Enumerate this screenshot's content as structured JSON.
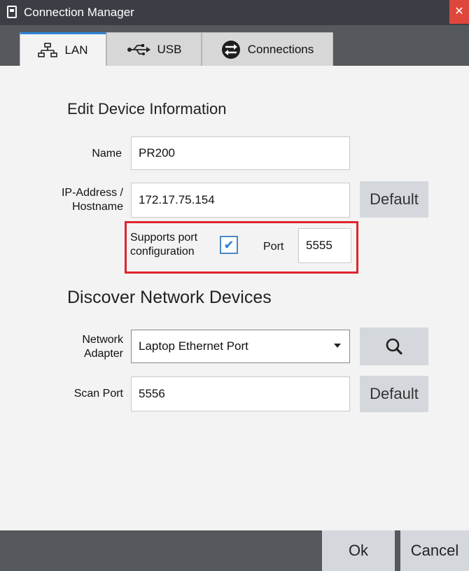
{
  "window": {
    "title": "Connection Manager",
    "close_glyph": "✕"
  },
  "tabs": [
    {
      "label": "LAN",
      "icon": "lan-network-icon",
      "active": true
    },
    {
      "label": "USB",
      "icon": "usb-icon",
      "active": false
    },
    {
      "label": "Connections",
      "icon": "connections-swap-icon",
      "active": false
    }
  ],
  "edit_section": {
    "title": "Edit Device Information",
    "name_label": "Name",
    "name_value": "PR200",
    "ip_label_line1": "IP-Address /",
    "ip_label_line2": "Hostname",
    "ip_value": "172.17.75.154",
    "default_label": "Default",
    "supports_port_line1": "Supports port",
    "supports_port_line2": "configuration",
    "supports_port_checked": true,
    "checkmark_glyph": "✔",
    "port_label": "Port",
    "port_value": "5555"
  },
  "discover_section": {
    "title": "Discover Network Devices",
    "adapter_label_line1": "Network",
    "adapter_label_line2": "Adapter",
    "adapter_value": "Laptop Ethernet Port",
    "search_icon": "magnifier-icon",
    "scan_port_label": "Scan Port",
    "scan_port_value": "5556",
    "default_label": "Default"
  },
  "footer": {
    "ok_label": "Ok",
    "cancel_label": "Cancel"
  },
  "colors": {
    "titlebar": "#3b3f45",
    "tab_accent": "#2f86d6",
    "highlight": "#e0242c",
    "close": "#e0473c"
  }
}
